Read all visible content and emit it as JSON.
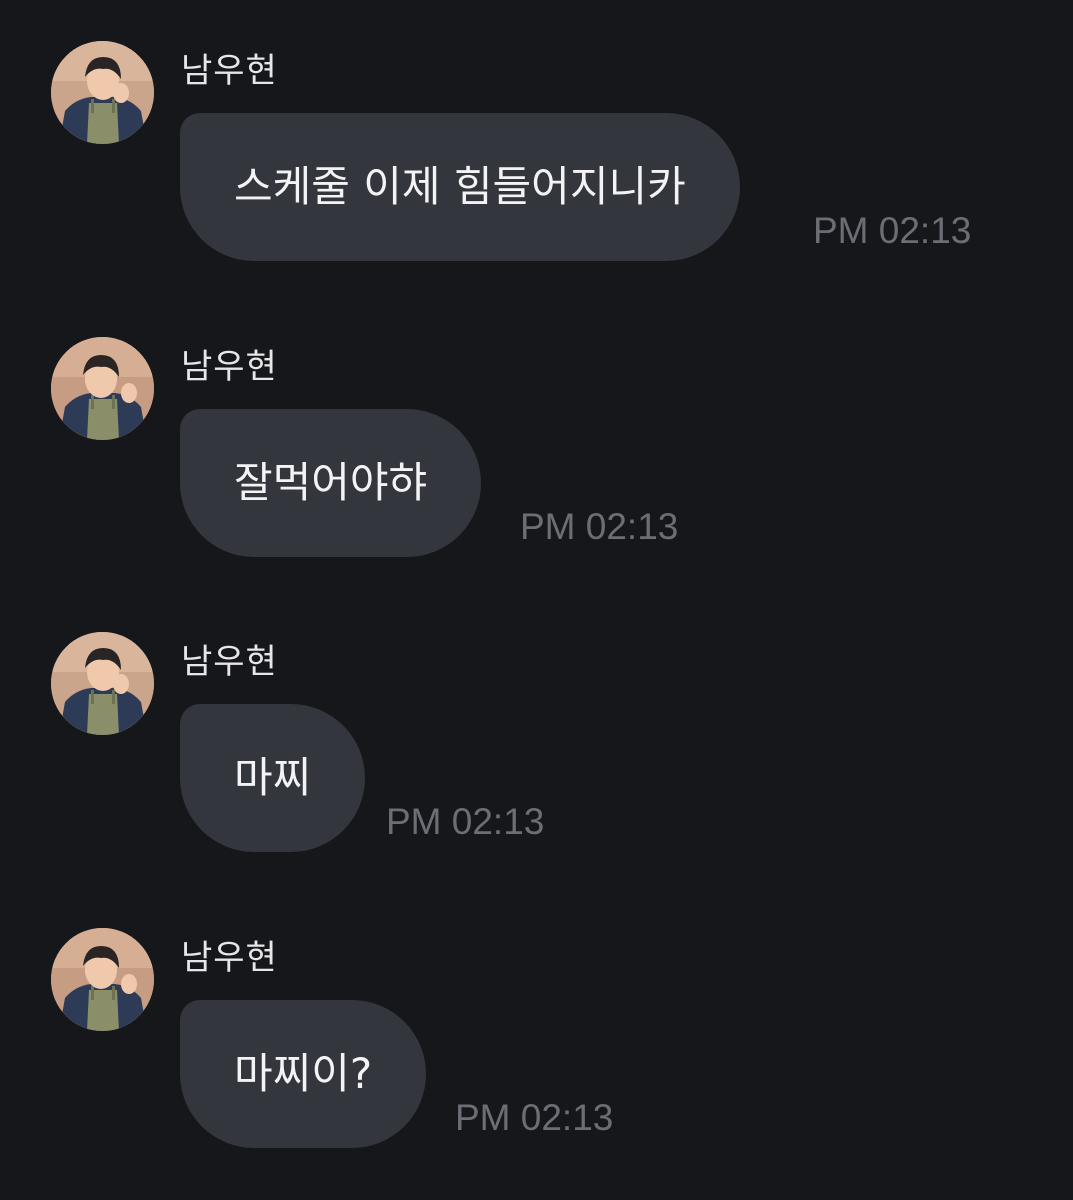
{
  "messages": [
    {
      "sender": "남우현",
      "text": "스케줄 이제 힘들어지니카",
      "time": "PM 02:13"
    },
    {
      "sender": "남우현",
      "text": "잘먹어야햐",
      "time": "PM 02:13"
    },
    {
      "sender": "남우현",
      "text": "마찌",
      "time": "PM 02:13"
    },
    {
      "sender": "남우현",
      "text": "마찌이?",
      "time": "PM 02:13"
    }
  ],
  "colors": {
    "background": "#16171b",
    "bubble": "#33363c",
    "message_text": "#f3f3f5",
    "sender_text": "#e6e6e9",
    "timestamp_text": "#6b6e75"
  },
  "icons": {
    "avatar": "profile-photo"
  }
}
